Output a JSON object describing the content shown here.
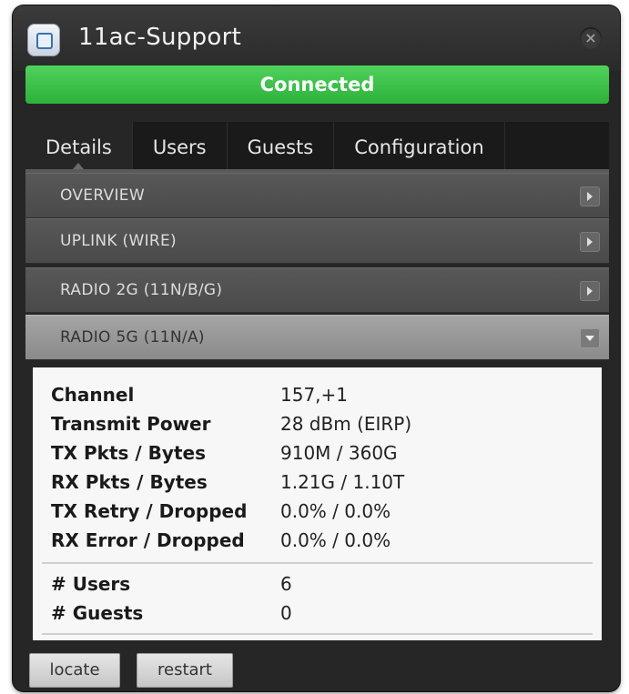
{
  "window": {
    "title": "11ac-Support",
    "close_icon": "close-icon",
    "app_icon": "device-icon"
  },
  "status": {
    "label": "Connected",
    "color": "#39c146"
  },
  "tabs": [
    {
      "label": "Details",
      "active": true
    },
    {
      "label": "Users",
      "active": false
    },
    {
      "label": "Guests",
      "active": false
    },
    {
      "label": "Configuration",
      "active": false
    }
  ],
  "sections": [
    {
      "label": "OVERVIEW",
      "expanded": false
    },
    {
      "label": "UPLINK (WIRE)",
      "expanded": false
    },
    {
      "label": "RADIO 2G (11N/B/G)",
      "expanded": false
    },
    {
      "label": "RADIO 5G (11N/A)",
      "expanded": true
    }
  ],
  "radio5g": {
    "stats": [
      {
        "label": "Channel",
        "value": "157,+1"
      },
      {
        "label": "Transmit Power",
        "value": "28 dBm (EIRP)"
      },
      {
        "label": "TX Pkts / Bytes",
        "value": "910M / 360G"
      },
      {
        "label": "RX Pkts / Bytes",
        "value": "1.21G / 1.10T"
      },
      {
        "label": "TX Retry / Dropped",
        "value": "0.0% / 0.0%"
      },
      {
        "label": "RX Error / Dropped",
        "value": "0.0% / 0.0%"
      }
    ],
    "counts": [
      {
        "label": "# Users",
        "value": "6"
      },
      {
        "label": "# Guests",
        "value": "0"
      }
    ]
  },
  "actions": {
    "locate": "locate",
    "restart": "restart"
  }
}
